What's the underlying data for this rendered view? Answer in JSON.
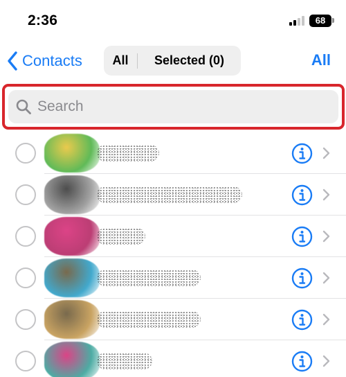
{
  "status_bar": {
    "time": "2:36",
    "battery_level": "68"
  },
  "nav": {
    "back_label": "Contacts",
    "segments": {
      "all": "All",
      "selected": "Selected (0)"
    },
    "select_all_label": "All"
  },
  "search": {
    "placeholder": "Search"
  },
  "colors": {
    "accent": "#1a7cf5",
    "highlight": "#d8262c"
  },
  "contacts": [
    {
      "avatar_colors": [
        "#e9c53a",
        "#4fb346"
      ]
    },
    {
      "avatar_colors": [
        "#3a3a3a",
        "#9a9a9a"
      ]
    },
    {
      "avatar_colors": [
        "#d8307a",
        "#b52a66"
      ]
    },
    {
      "avatar_colors": [
        "#6b5a3a",
        "#2ea0c8"
      ]
    },
    {
      "avatar_colors": [
        "#6b5a3a",
        "#c49a52"
      ]
    },
    {
      "avatar_colors": [
        "#d8307a",
        "#3aa39a"
      ]
    }
  ]
}
